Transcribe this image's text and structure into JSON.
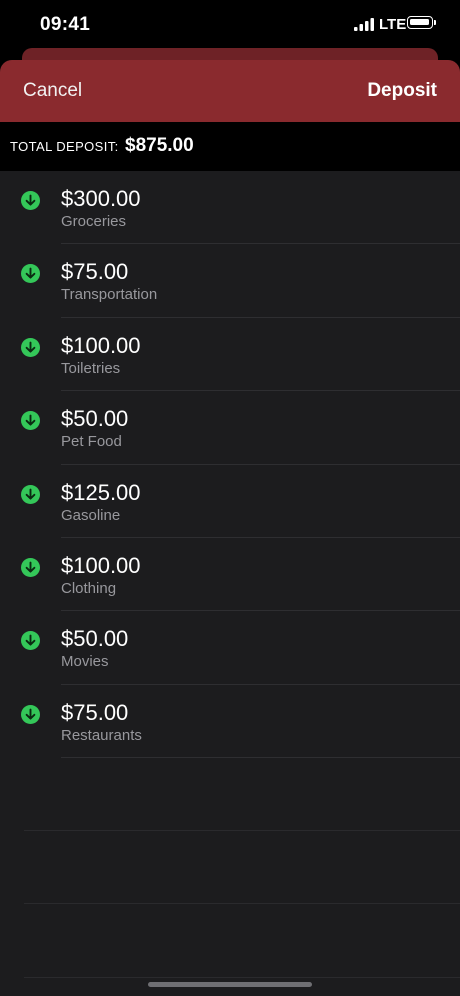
{
  "status": {
    "time": "09:41",
    "network": "LTE"
  },
  "nav": {
    "cancel_label": "Cancel",
    "deposit_label": "Deposit",
    "color": "#8a2a2e"
  },
  "total": {
    "label": "TOTAL DEPOSIT:",
    "value": "$875.00"
  },
  "items": [
    {
      "amount": "$300.00",
      "category": "Groceries",
      "icon": "arrow-down-circle-icon"
    },
    {
      "amount": "$75.00",
      "category": "Transportation",
      "icon": "arrow-down-circle-icon"
    },
    {
      "amount": "$100.00",
      "category": "Toiletries",
      "icon": "arrow-down-circle-icon"
    },
    {
      "amount": "$50.00",
      "category": "Pet Food",
      "icon": "arrow-down-circle-icon"
    },
    {
      "amount": "$125.00",
      "category": "Gasoline",
      "icon": "arrow-down-circle-icon"
    },
    {
      "amount": "$100.00",
      "category": "Clothing",
      "icon": "arrow-down-circle-icon"
    },
    {
      "amount": "$50.00",
      "category": "Movies",
      "icon": "arrow-down-circle-icon"
    },
    {
      "amount": "$75.00",
      "category": "Restaurants",
      "icon": "arrow-down-circle-icon"
    }
  ],
  "colors": {
    "accent_green": "#34c759",
    "background": "#1c1c1e"
  }
}
